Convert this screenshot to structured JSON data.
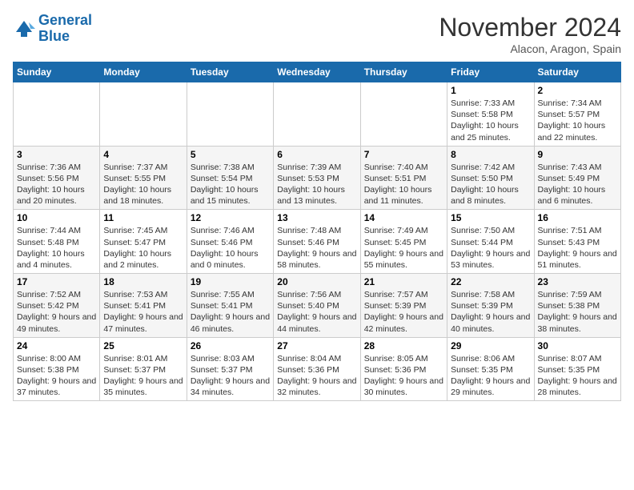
{
  "header": {
    "logo_line1": "General",
    "logo_line2": "Blue",
    "month": "November 2024",
    "location": "Alacon, Aragon, Spain"
  },
  "days_of_week": [
    "Sunday",
    "Monday",
    "Tuesday",
    "Wednesday",
    "Thursday",
    "Friday",
    "Saturday"
  ],
  "weeks": [
    [
      {
        "day": "",
        "content": ""
      },
      {
        "day": "",
        "content": ""
      },
      {
        "day": "",
        "content": ""
      },
      {
        "day": "",
        "content": ""
      },
      {
        "day": "",
        "content": ""
      },
      {
        "day": "1",
        "content": "Sunrise: 7:33 AM\nSunset: 5:58 PM\nDaylight: 10 hours and 25 minutes."
      },
      {
        "day": "2",
        "content": "Sunrise: 7:34 AM\nSunset: 5:57 PM\nDaylight: 10 hours and 22 minutes."
      }
    ],
    [
      {
        "day": "3",
        "content": "Sunrise: 7:36 AM\nSunset: 5:56 PM\nDaylight: 10 hours and 20 minutes."
      },
      {
        "day": "4",
        "content": "Sunrise: 7:37 AM\nSunset: 5:55 PM\nDaylight: 10 hours and 18 minutes."
      },
      {
        "day": "5",
        "content": "Sunrise: 7:38 AM\nSunset: 5:54 PM\nDaylight: 10 hours and 15 minutes."
      },
      {
        "day": "6",
        "content": "Sunrise: 7:39 AM\nSunset: 5:53 PM\nDaylight: 10 hours and 13 minutes."
      },
      {
        "day": "7",
        "content": "Sunrise: 7:40 AM\nSunset: 5:51 PM\nDaylight: 10 hours and 11 minutes."
      },
      {
        "day": "8",
        "content": "Sunrise: 7:42 AM\nSunset: 5:50 PM\nDaylight: 10 hours and 8 minutes."
      },
      {
        "day": "9",
        "content": "Sunrise: 7:43 AM\nSunset: 5:49 PM\nDaylight: 10 hours and 6 minutes."
      }
    ],
    [
      {
        "day": "10",
        "content": "Sunrise: 7:44 AM\nSunset: 5:48 PM\nDaylight: 10 hours and 4 minutes."
      },
      {
        "day": "11",
        "content": "Sunrise: 7:45 AM\nSunset: 5:47 PM\nDaylight: 10 hours and 2 minutes."
      },
      {
        "day": "12",
        "content": "Sunrise: 7:46 AM\nSunset: 5:46 PM\nDaylight: 10 hours and 0 minutes."
      },
      {
        "day": "13",
        "content": "Sunrise: 7:48 AM\nSunset: 5:46 PM\nDaylight: 9 hours and 58 minutes."
      },
      {
        "day": "14",
        "content": "Sunrise: 7:49 AM\nSunset: 5:45 PM\nDaylight: 9 hours and 55 minutes."
      },
      {
        "day": "15",
        "content": "Sunrise: 7:50 AM\nSunset: 5:44 PM\nDaylight: 9 hours and 53 minutes."
      },
      {
        "day": "16",
        "content": "Sunrise: 7:51 AM\nSunset: 5:43 PM\nDaylight: 9 hours and 51 minutes."
      }
    ],
    [
      {
        "day": "17",
        "content": "Sunrise: 7:52 AM\nSunset: 5:42 PM\nDaylight: 9 hours and 49 minutes."
      },
      {
        "day": "18",
        "content": "Sunrise: 7:53 AM\nSunset: 5:41 PM\nDaylight: 9 hours and 47 minutes."
      },
      {
        "day": "19",
        "content": "Sunrise: 7:55 AM\nSunset: 5:41 PM\nDaylight: 9 hours and 46 minutes."
      },
      {
        "day": "20",
        "content": "Sunrise: 7:56 AM\nSunset: 5:40 PM\nDaylight: 9 hours and 44 minutes."
      },
      {
        "day": "21",
        "content": "Sunrise: 7:57 AM\nSunset: 5:39 PM\nDaylight: 9 hours and 42 minutes."
      },
      {
        "day": "22",
        "content": "Sunrise: 7:58 AM\nSunset: 5:39 PM\nDaylight: 9 hours and 40 minutes."
      },
      {
        "day": "23",
        "content": "Sunrise: 7:59 AM\nSunset: 5:38 PM\nDaylight: 9 hours and 38 minutes."
      }
    ],
    [
      {
        "day": "24",
        "content": "Sunrise: 8:00 AM\nSunset: 5:38 PM\nDaylight: 9 hours and 37 minutes."
      },
      {
        "day": "25",
        "content": "Sunrise: 8:01 AM\nSunset: 5:37 PM\nDaylight: 9 hours and 35 minutes."
      },
      {
        "day": "26",
        "content": "Sunrise: 8:03 AM\nSunset: 5:37 PM\nDaylight: 9 hours and 34 minutes."
      },
      {
        "day": "27",
        "content": "Sunrise: 8:04 AM\nSunset: 5:36 PM\nDaylight: 9 hours and 32 minutes."
      },
      {
        "day": "28",
        "content": "Sunrise: 8:05 AM\nSunset: 5:36 PM\nDaylight: 9 hours and 30 minutes."
      },
      {
        "day": "29",
        "content": "Sunrise: 8:06 AM\nSunset: 5:35 PM\nDaylight: 9 hours and 29 minutes."
      },
      {
        "day": "30",
        "content": "Sunrise: 8:07 AM\nSunset: 5:35 PM\nDaylight: 9 hours and 28 minutes."
      }
    ]
  ]
}
